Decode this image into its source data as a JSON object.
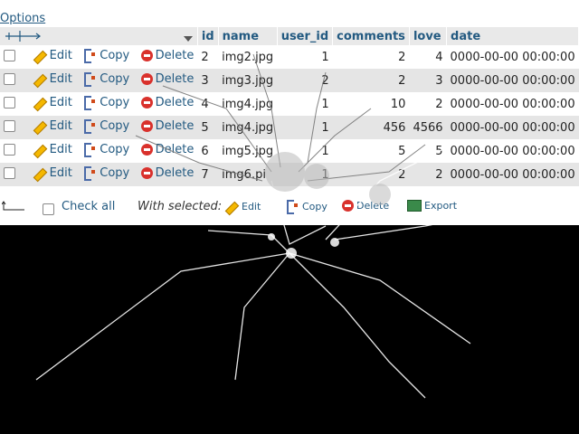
{
  "options_label": "Options",
  "columns": [
    "id",
    "name",
    "user_id",
    "comments",
    "love",
    "date"
  ],
  "rows": [
    {
      "id": "2",
      "name": "img2.jpg",
      "user_id": "1",
      "comments": "2",
      "love": "4",
      "date": "0000-00-00 00:00:00"
    },
    {
      "id": "3",
      "name": "img3.jpg",
      "user_id": "2",
      "comments": "2",
      "love": "3",
      "date": "0000-00-00 00:00:00"
    },
    {
      "id": "4",
      "name": "img4.jpg",
      "user_id": "1",
      "comments": "10",
      "love": "2",
      "date": "0000-00-00 00:00:00"
    },
    {
      "id": "5",
      "name": "img4.jpg",
      "user_id": "1",
      "comments": "456",
      "love": "4566",
      "date": "0000-00-00 00:00:00"
    },
    {
      "id": "6",
      "name": "img5.jpg",
      "user_id": "1",
      "comments": "5",
      "love": "5",
      "date": "0000-00-00 00:00:00"
    },
    {
      "id": "7",
      "name": "img6.pi",
      "user_id": "1",
      "comments": "2",
      "love": "2",
      "date": "0000-00-00 00:00:00"
    }
  ],
  "row_actions": {
    "edit": "Edit",
    "copy": "Copy",
    "delete": "Delete"
  },
  "bottom": {
    "check_all": "Check all",
    "with_selected": "With selected:",
    "edit": "Edit",
    "copy": "Copy",
    "delete": "Delete",
    "export": "Export"
  },
  "icons": [
    "sort-arrows-icon",
    "sort-dropdown-icon",
    "pencil-icon",
    "copy-icon",
    "delete-icon",
    "return-arrow-icon",
    "export-icon"
  ],
  "colors": {
    "link": "#235a81",
    "row_alt": "#e5e5e5",
    "header_bg": "#e9e9e9",
    "screen_black": "#000000"
  }
}
